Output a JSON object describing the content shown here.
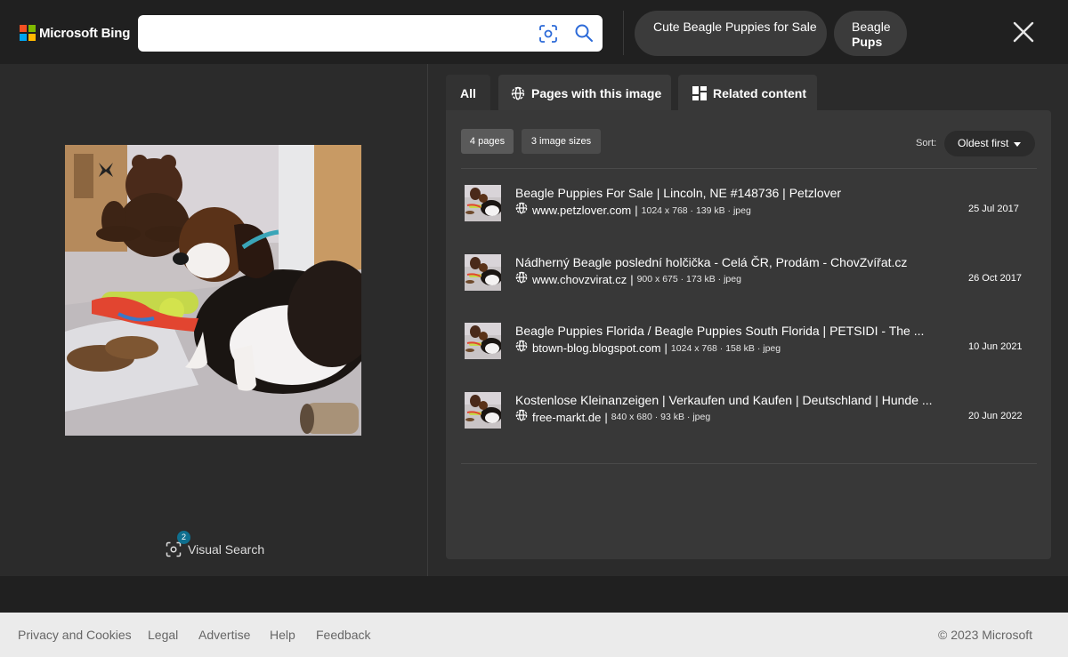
{
  "header": {
    "brand": "Microsoft Bing",
    "search_value": "",
    "chips": [
      {
        "label": "Cute Beagle Puppies for Sale"
      },
      {
        "label_line1": "Beagle",
        "label_line2": "Pups"
      }
    ]
  },
  "left": {
    "visual_search_label": "Visual Search",
    "visual_search_badge": "2"
  },
  "tabs": {
    "all": "All",
    "pages": "Pages with this image",
    "related": "Related content"
  },
  "filters": {
    "pages": "4 pages",
    "sizes": "3 image sizes",
    "sort_label": "Sort:",
    "sort_value": "Oldest first"
  },
  "results": [
    {
      "title": "Beagle Puppies For Sale | Lincoln, NE #148736 | Petzlover",
      "domain": "www.petzlover.com",
      "details": "1024 x 768 · 139 kB · jpeg",
      "date": "25 Jul 2017"
    },
    {
      "title": "Nádherný Beagle poslední holčička - Celá ČR, Prodám - ChovZvířat.cz",
      "domain": "www.chovzvirat.cz",
      "details": "900 x 675 · 173 kB · jpeg",
      "date": "26 Oct 2017"
    },
    {
      "title": "Beagle Puppies Florida / Beagle Puppies South Florida | PETSIDI - The ...",
      "domain": "btown-blog.blogspot.com",
      "details": "1024 x 768 · 158 kB · jpeg",
      "date": "10 Jun 2021"
    },
    {
      "title": "Kostenlose Kleinanzeigen | Verkaufen und Kaufen | Deutschland | Hunde ...",
      "domain": "free-markt.de",
      "details": "840 x 680 · 93 kB · jpeg",
      "date": "20 Jun 2022"
    }
  ],
  "footer": {
    "links": [
      "Privacy and Cookies",
      "Legal",
      "Advertise",
      "Help",
      "Feedback"
    ],
    "copyright": "© 2023 Microsoft"
  },
  "colors": {
    "header_bg": "#202020",
    "pane_bg": "#2b2b2b",
    "panel_bg": "#383838",
    "footer_bg": "#ebebeb",
    "badge": "#0f6f8f",
    "logo": [
      "#f25022",
      "#7fba00",
      "#00a4ef",
      "#ffb900"
    ]
  },
  "icons": [
    "microsoft-logo-icon",
    "visual-search-icon",
    "search-icon",
    "close-icon",
    "globe-icon",
    "related-grid-icon",
    "chevron-down-icon"
  ]
}
